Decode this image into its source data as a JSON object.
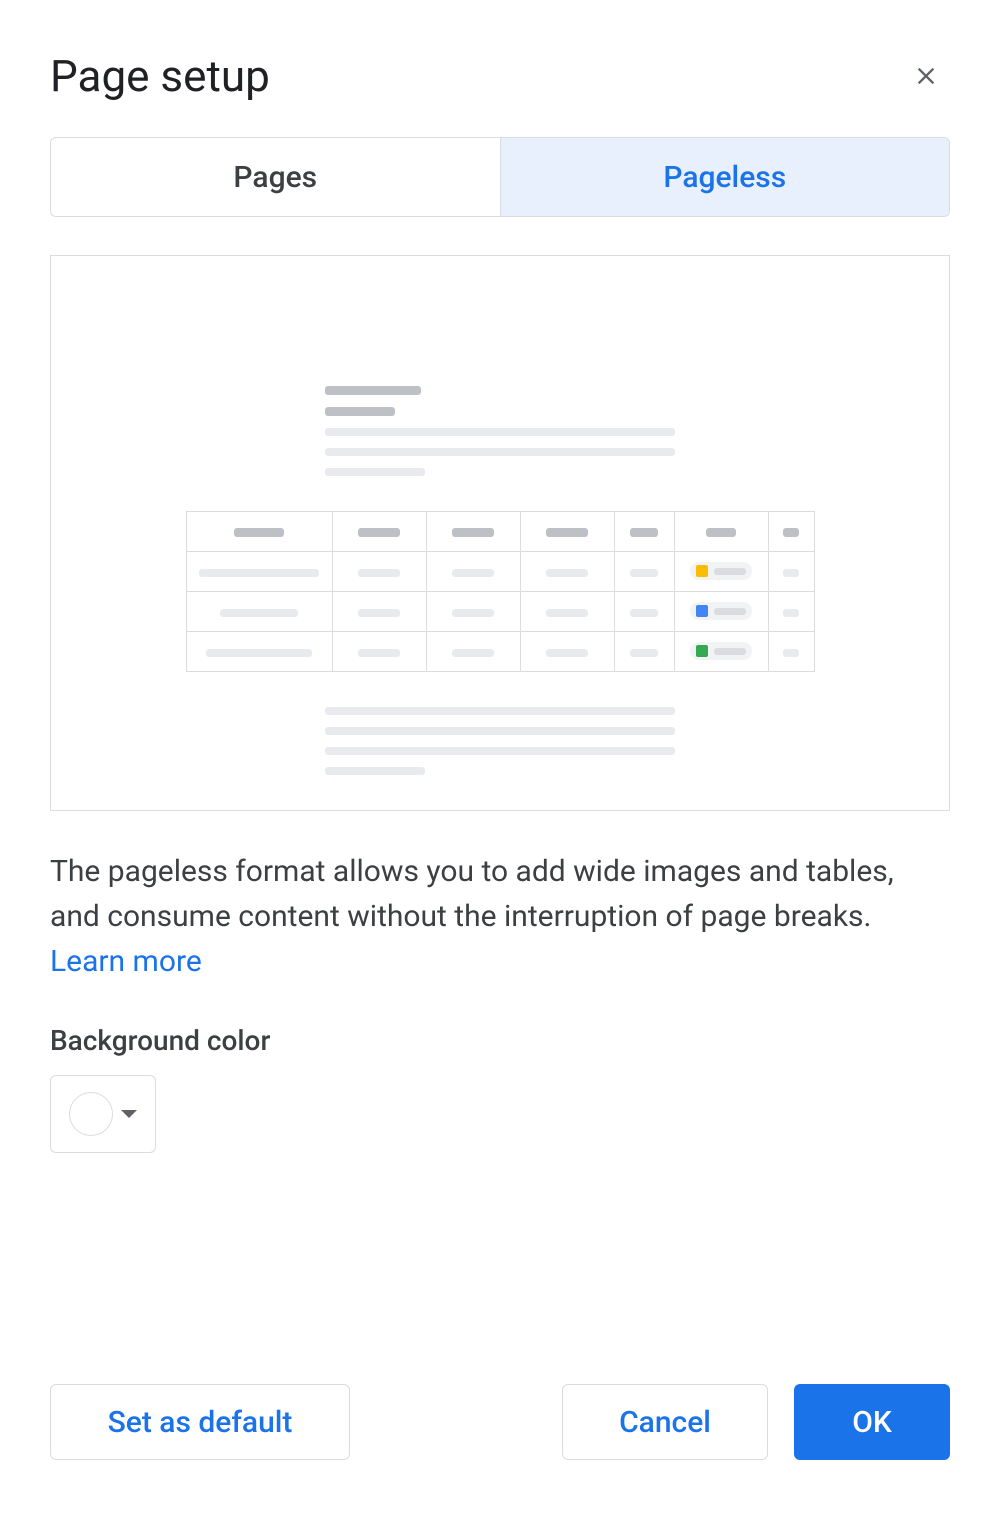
{
  "dialog": {
    "title": "Page setup"
  },
  "tabs": {
    "pages": "Pages",
    "pageless": "Pageless"
  },
  "description": {
    "text": "The pageless format allows you to add wide images and tables, and consume content without the interruption of page breaks. ",
    "learn_more": "Learn more"
  },
  "background": {
    "label": "Background color",
    "selected_color": "#ffffff"
  },
  "buttons": {
    "set_default": "Set as default",
    "cancel": "Cancel",
    "ok": "OK"
  }
}
